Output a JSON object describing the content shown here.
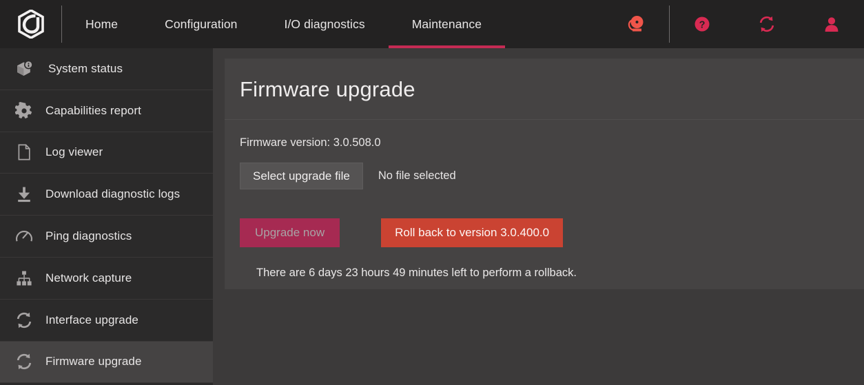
{
  "header": {
    "logo_icon": "hexagon-swirl-logo",
    "tabs": [
      {
        "label": "Home",
        "active": false
      },
      {
        "label": "Configuration",
        "active": false
      },
      {
        "label": "I/O diagnostics",
        "active": false
      },
      {
        "label": "Maintenance",
        "active": true
      }
    ],
    "icons": [
      {
        "name": "alarm-bell-icon",
        "color": "#f0554a"
      },
      {
        "name": "help-circle-icon",
        "color": "#d82a52"
      },
      {
        "name": "refresh-sync-icon",
        "color": "#d82a52"
      },
      {
        "name": "user-account-icon",
        "color": "#d82a52"
      }
    ],
    "active_tab_underline_color": "#c42b54",
    "background_color": "#232222"
  },
  "sidebar": {
    "items": [
      {
        "label": "System status",
        "icon": "package-info-icon",
        "active": false
      },
      {
        "label": "Capabilities report",
        "icon": "gear-icon",
        "active": false
      },
      {
        "label": "Log viewer",
        "icon": "document-page-icon",
        "active": false
      },
      {
        "label": "Download diagnostic logs",
        "icon": "download-icon",
        "active": false
      },
      {
        "label": "Ping diagnostics",
        "icon": "gauge-icon",
        "active": false
      },
      {
        "label": "Network capture",
        "icon": "sitemap-icon",
        "active": false
      },
      {
        "label": "Interface upgrade",
        "icon": "refresh-sync-icon",
        "active": false
      },
      {
        "label": "Firmware upgrade",
        "icon": "refresh-sync-icon",
        "active": true
      }
    ],
    "background_color": "#2b2a2a",
    "active_background_color": "#454343"
  },
  "main": {
    "page_title": "Firmware upgrade",
    "firmware_version_text": "Firmware version: 3.0.508.0",
    "select_file_button": "Select upgrade file",
    "file_status": "No file selected",
    "upgrade_button": "Upgrade now",
    "rollback_button": "Roll back to version 3.0.400.0",
    "rollback_note": "There are 6 days 23 hours 49 minutes left to perform a rollback.",
    "card_background_color": "#454343",
    "page_background_color": "#3c3a3a",
    "upgrade_button_color": "#a62a52",
    "rollback_button_color": "#ca4332"
  }
}
